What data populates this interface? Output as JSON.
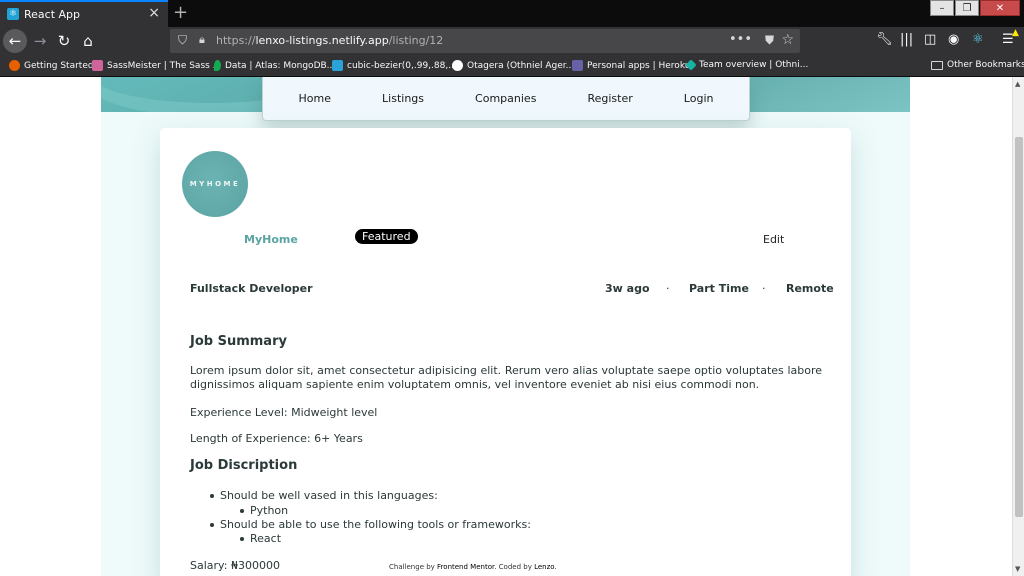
{
  "browser": {
    "tab_title": "React App",
    "url_base": "https://",
    "url_host": "lenxo-listings.netlify.app",
    "url_path": "/listing/12",
    "bookmarks": [
      {
        "label": "Getting Started",
        "color": "#e66000"
      },
      {
        "label": "SassMeister | The Sass ...",
        "color": "#cf649a"
      },
      {
        "label": "Data | Atlas: MongoDB...",
        "color": "#13aa52"
      },
      {
        "label": "cubic-bezier(0,.99,.88,...",
        "color": "#2aa3d8"
      },
      {
        "label": "Otagera (Othniel Ager...",
        "color": "#ffffff"
      },
      {
        "label": "Personal apps | Heroku",
        "color": "#6762a6"
      },
      {
        "label": "Team overview | Othni...",
        "color": "#17b3a3"
      }
    ],
    "other_bookmarks": "Other Bookmarks"
  },
  "nav": {
    "items": [
      "Home",
      "Listings",
      "Companies",
      "Register",
      "Login"
    ]
  },
  "listing": {
    "logo_text": "MYHOME",
    "company": "MyHome",
    "badge": "Featured",
    "edit": "Edit",
    "position": "Fullstack Developer",
    "posted": "3w ago",
    "contract": "Part Time",
    "location": "Remote",
    "separator": "·",
    "summary_heading": "Job Summary",
    "summary_text": "Lorem ipsum dolor sit, amet consectetur adipisicing elit. Rerum vero alias voluptate saepe optio voluptates labore dignissimos aliquam sapiente enim voluptatem omnis, vel inventore eveniet ab nisi eius commodi non.",
    "experience_level": "Experience Level: Midweight level",
    "experience_length": "Length of Experience: 6+ Years",
    "description_heading": "Job Discription",
    "requirements": [
      {
        "text": "Should be well vased in this languages:",
        "sub": [
          "Python"
        ]
      },
      {
        "text": "Should be able to use the following tools or frameworks:",
        "sub": [
          "React"
        ]
      }
    ],
    "salary": "Salary: ₦300000"
  },
  "footer": {
    "prefix": "Challenge by ",
    "link1": "Frontend Mentor",
    "middle": ". Coded by ",
    "link2": "Lenzo",
    "suffix": "."
  }
}
